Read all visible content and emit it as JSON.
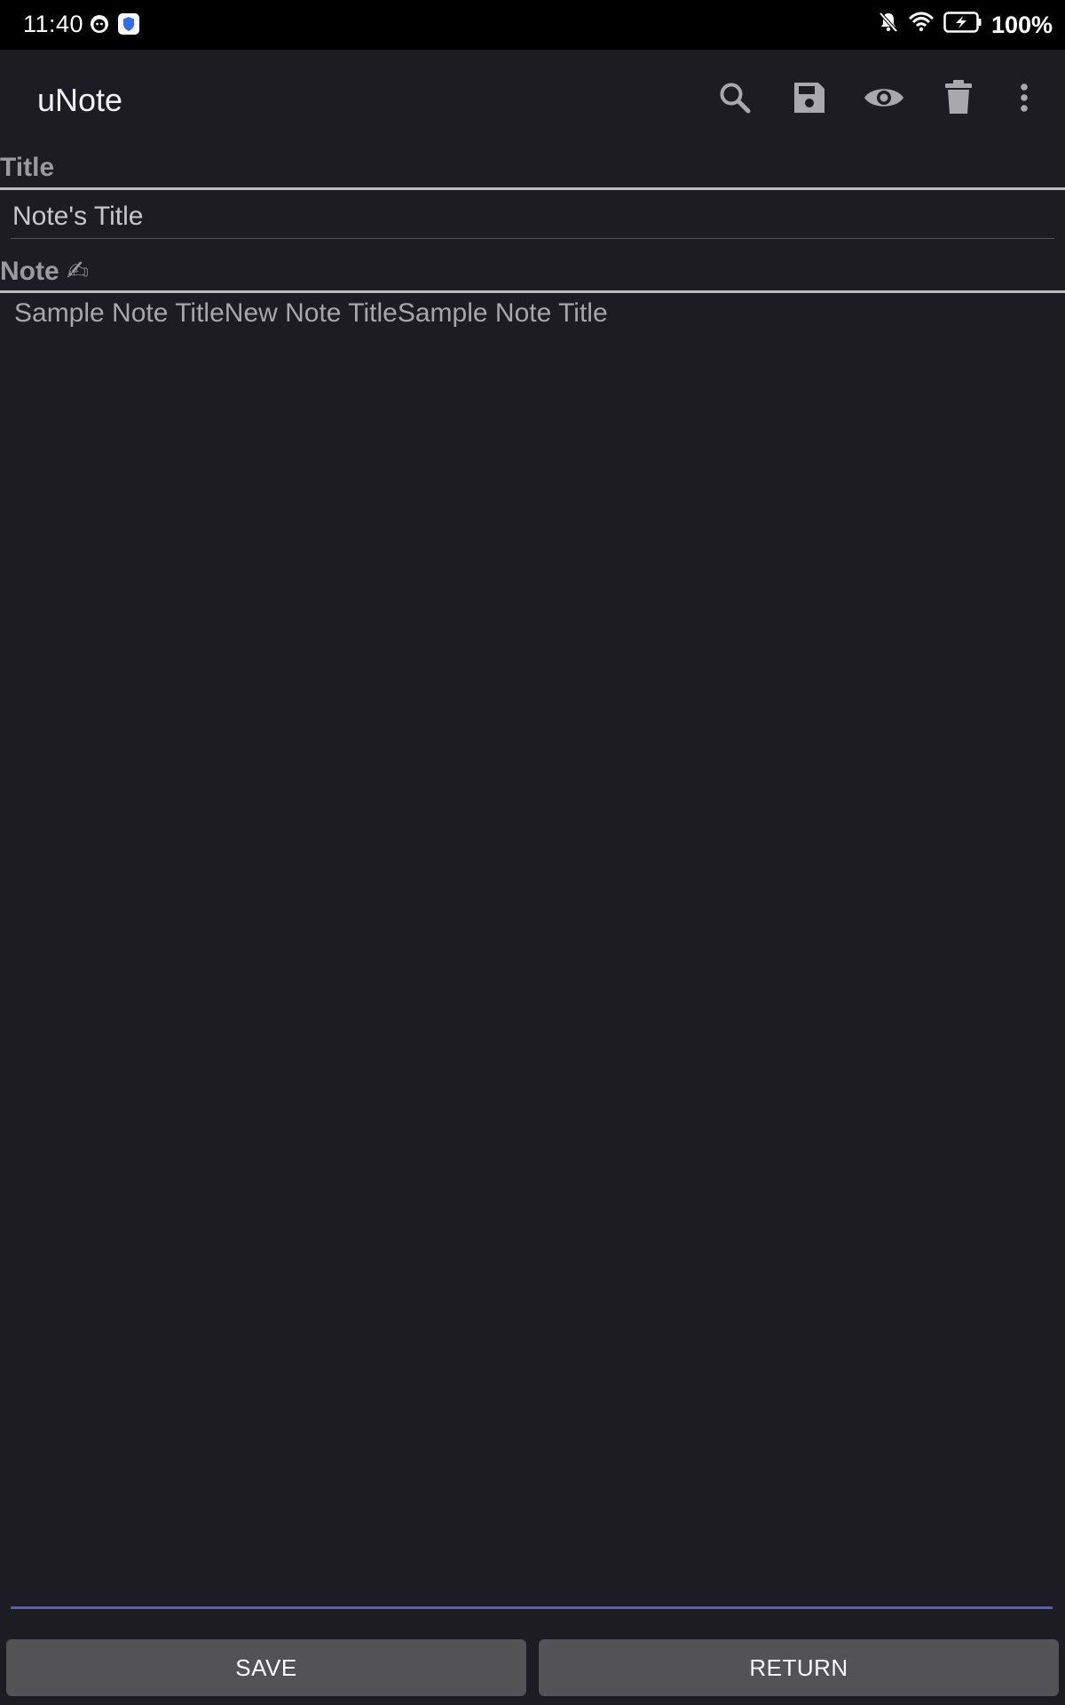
{
  "status_bar": {
    "time": "11:40",
    "battery": "100%",
    "icons": [
      "notification-app-icon",
      "vpn-shield-icon",
      "bell-off-icon",
      "wifi-icon",
      "battery-charging-icon"
    ]
  },
  "app_bar": {
    "title": "uNote",
    "actions": [
      "search-icon",
      "save-icon",
      "preview-eye-icon",
      "delete-icon",
      "more-vert-icon"
    ]
  },
  "title_section": {
    "label": "Title",
    "input_value": "Note's Title"
  },
  "note_section": {
    "label": "Note ✍",
    "input_value": "Sample Note TitleNew Note TitleSample Note Title"
  },
  "buttons": {
    "save_label": "SAVE",
    "return_label": "RETURN"
  },
  "colors": {
    "background": "#1d1c22",
    "status_bar": "#000000",
    "button": "#535356",
    "focus_underline": "#5b5fa8",
    "icon": "#a8a8ad"
  }
}
